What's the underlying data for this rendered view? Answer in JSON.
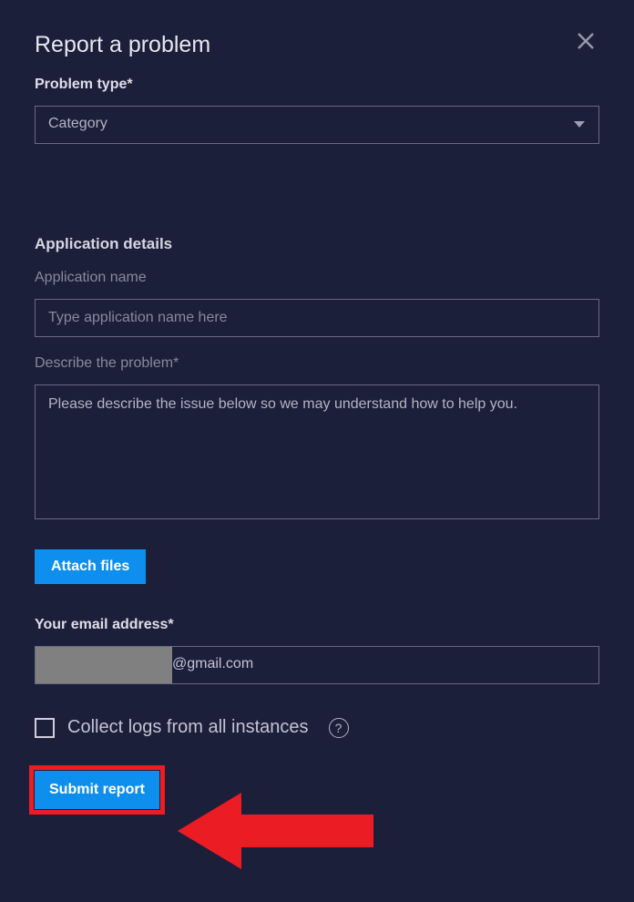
{
  "dialog": {
    "title": "Report a problem"
  },
  "problemType": {
    "label": "Problem type*",
    "selected": "Category"
  },
  "appDetails": {
    "header": "Application details",
    "nameLabel": "Application name",
    "namePlaceholder": "Type application name here",
    "describeLabel": "Describe the problem*",
    "describePlaceholder": "Please describe the issue below so we may understand how to help you."
  },
  "buttons": {
    "attachFiles": "Attach files",
    "submitReport": "Submit report"
  },
  "email": {
    "label": "Your email address*",
    "domainSuffix": "@gmail.com"
  },
  "collectLogs": {
    "label": "Collect logs from all instances"
  },
  "annotationColor": "#ec1c24"
}
